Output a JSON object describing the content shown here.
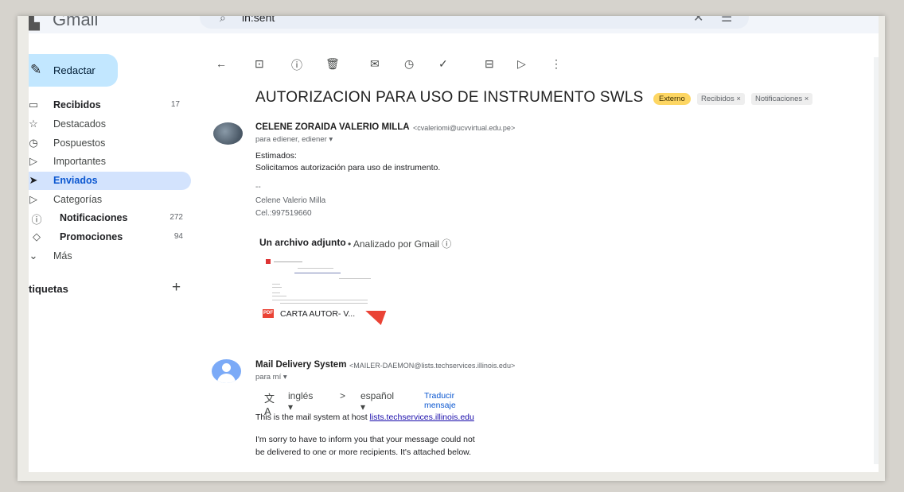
{
  "app": {
    "logo_text": "Gmail"
  },
  "search": {
    "query": "in:sent"
  },
  "sidebar": {
    "compose_label": "Redactar",
    "items": [
      {
        "label": "Recibidos",
        "count": "17",
        "bold": true
      },
      {
        "label": "Destacados",
        "count": "",
        "bold": false
      },
      {
        "label": "Pospuestos",
        "count": "",
        "bold": false
      },
      {
        "label": "Importantes",
        "count": "",
        "bold": false
      },
      {
        "label": "Enviados",
        "count": "",
        "bold": true
      },
      {
        "label": "Categorías",
        "count": "",
        "bold": false
      },
      {
        "label": "Notificaciones",
        "count": "272",
        "bold": true
      },
      {
        "label": "Promociones",
        "count": "94",
        "bold": true
      },
      {
        "label": "Más",
        "count": "",
        "bold": false
      }
    ],
    "labels_title": "tiquetas",
    "labels_plus": "+"
  },
  "email": {
    "subject": "AUTORIZACION PARA USO DE INSTRUMENTO SWLS",
    "chips": [
      "Externo",
      "Recibidos ×",
      "Notificaciones ×"
    ],
    "message1": {
      "sender": "CELENE ZORAIDA VALERIO MILLA",
      "sender_email": "<cvaleriomi@ucvvirtual.edu.pe>",
      "to": "para ediener, ediener ▾",
      "greeting": "Estimados:",
      "body": "Solicitamos autorización para uso de instrumento.",
      "sig_sep": "--",
      "sig_name": "Celene Valerio Milla",
      "sig_phone": "Cel.:997519660",
      "attachment_title": "Un archivo adjunto",
      "attachment_scan": "• Analizado por Gmail ⓘ",
      "attachment_name": "CARTA AUTOR- V...",
      "pdf_badge": "PDF"
    },
    "message2": {
      "sender": "Mail Delivery System",
      "sender_email": "<MAILER-DAEMON@lists.techservices.illinois.edu>",
      "to": "para mí ▾",
      "from_lang": "inglés ▾",
      "arrow": ">",
      "to_lang": "español ▾",
      "translate_link": "Traducir mensaje",
      "line1_prefix": "This is the mail system at host ",
      "line1_link": "lists.techservices.illinois.edu",
      "line2": "I'm sorry to have to inform you that your message could not",
      "line3": "be delivered to one or more recipients. It's attached below."
    }
  },
  "colors": {
    "accent": "#c2e7ff",
    "active_nav": "#d3e3fd",
    "external_chip": "#fdd663",
    "pdf_red": "#ea4335"
  }
}
